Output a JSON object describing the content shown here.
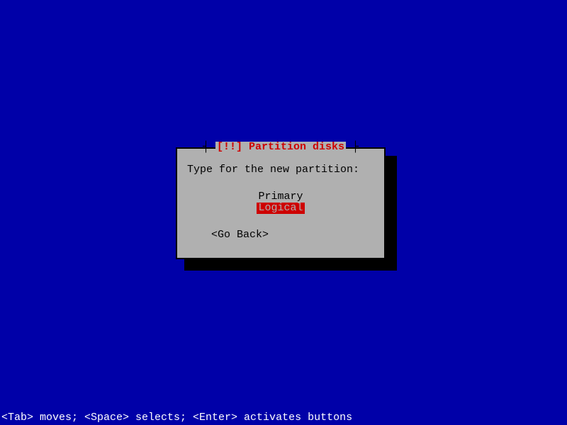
{
  "dialog": {
    "title": "[!!] Partition disks",
    "prompt": "Type for the new partition:",
    "options": [
      {
        "label": "Primary",
        "selected": false
      },
      {
        "label": "Logical",
        "selected": true
      }
    ],
    "go_back": "<Go Back>"
  },
  "footer": "<Tab> moves; <Space> selects; <Enter> activates buttons",
  "colors": {
    "background": "#0000A8",
    "dialog_bg": "#B0B0B0",
    "accent_red": "#CE0000",
    "shadow": "#000000",
    "footer_text": "#FFFFFF"
  }
}
